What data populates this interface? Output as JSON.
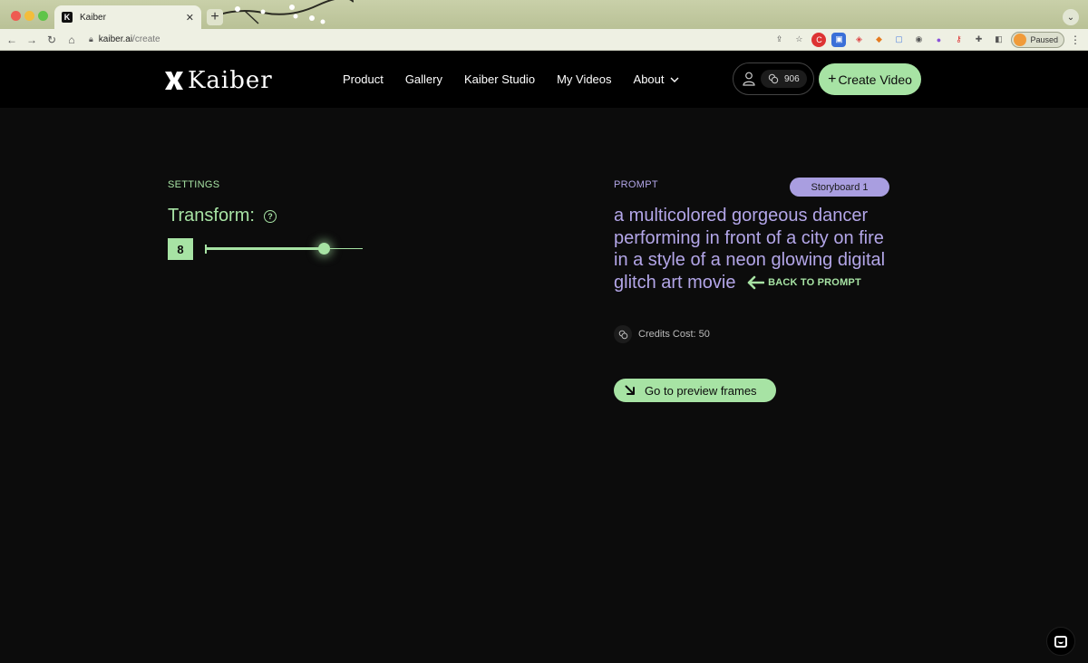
{
  "browser": {
    "tab_title": "Kaiber",
    "tab_close": "✕",
    "new_tab": "+",
    "url_host": "kaiber.ai",
    "url_path": "/create",
    "profile_label": "Paused"
  },
  "header": {
    "logo_text": "Kaiber",
    "nav": {
      "product": "Product",
      "gallery": "Gallery",
      "studio": "Kaiber Studio",
      "my_videos": "My Videos",
      "about": "About"
    },
    "credits": "906",
    "create_video": "Create Video",
    "create_plus": "+"
  },
  "settings": {
    "section_label": "SETTINGS",
    "transform_label": "Transform:",
    "transform_value": "8",
    "slider_fraction": 0.75
  },
  "prompt": {
    "section_label": "PROMPT",
    "storyboard_badge": "Storyboard 1",
    "text": "a multicolored gorgeous dancer performing in front of a city on fire in a style of a neon glowing digital glitch art movie",
    "back_link": "BACK TO PROMPT",
    "credits_cost": "Credits Cost: 50",
    "preview_button": "Go to preview frames"
  },
  "colors": {
    "accent_green": "#a7e3a4",
    "accent_purple": "#b3a6e8",
    "background": "#0c0c0c"
  }
}
